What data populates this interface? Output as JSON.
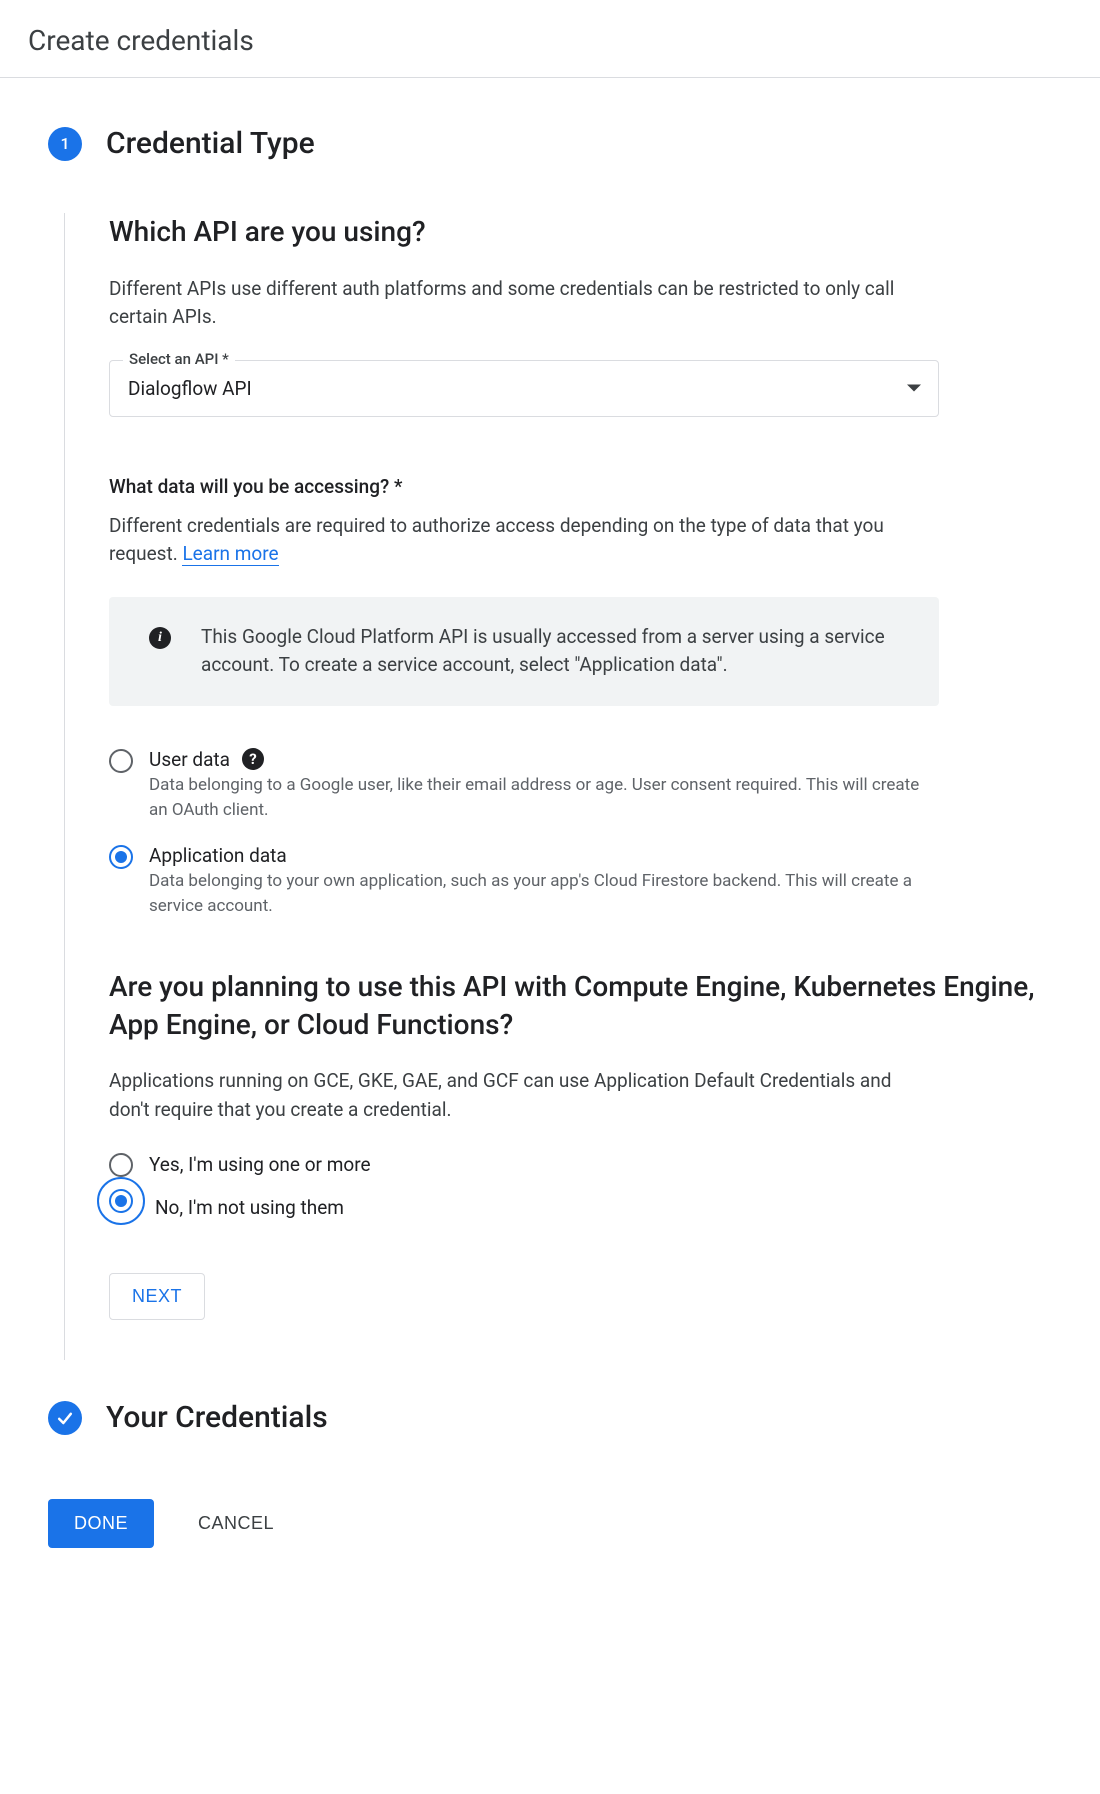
{
  "header": {
    "title": "Create credentials"
  },
  "step1": {
    "badge": "1",
    "title": "Credential Type",
    "api_section": {
      "heading": "Which API are you using?",
      "desc": "Different APIs use different auth platforms and some credentials can be restricted to only call certain APIs.",
      "select_label": "Select an API *",
      "select_value": "Dialogflow API"
    },
    "data_section": {
      "heading": "What data will you be accessing? *",
      "desc_prefix": "Different credentials are required to authorize access depending on the type of data that you request. ",
      "learn_more": "Learn more",
      "info_text": "This Google Cloud Platform API is usually accessed from a server using a service account. To create a service account, select \"Application data\".",
      "options": [
        {
          "label": "User data",
          "desc": "Data belonging to a Google user, like their email address or age. User consent required. This will create an OAuth client.",
          "selected": false,
          "has_help": true
        },
        {
          "label": "Application data",
          "desc": "Data belonging to your own application, such as your app's Cloud Firestore backend. This will create a service account.",
          "selected": true,
          "has_help": false
        }
      ]
    },
    "platform_section": {
      "heading": "Are you planning to use this API with Compute Engine, Kubernetes Engine, App Engine, or Cloud Functions?",
      "desc": "Applications running on GCE, GKE, GAE, and GCF can use Application Default Credentials and don't require that you create a credential.",
      "options": [
        {
          "label": "Yes, I'm using one or more",
          "selected": false,
          "focused": false
        },
        {
          "label": "No, I'm not using them",
          "selected": true,
          "focused": true
        }
      ]
    },
    "next_label": "NEXT"
  },
  "step2": {
    "title": "Your Credentials"
  },
  "footer": {
    "done": "DONE",
    "cancel": "CANCEL"
  }
}
